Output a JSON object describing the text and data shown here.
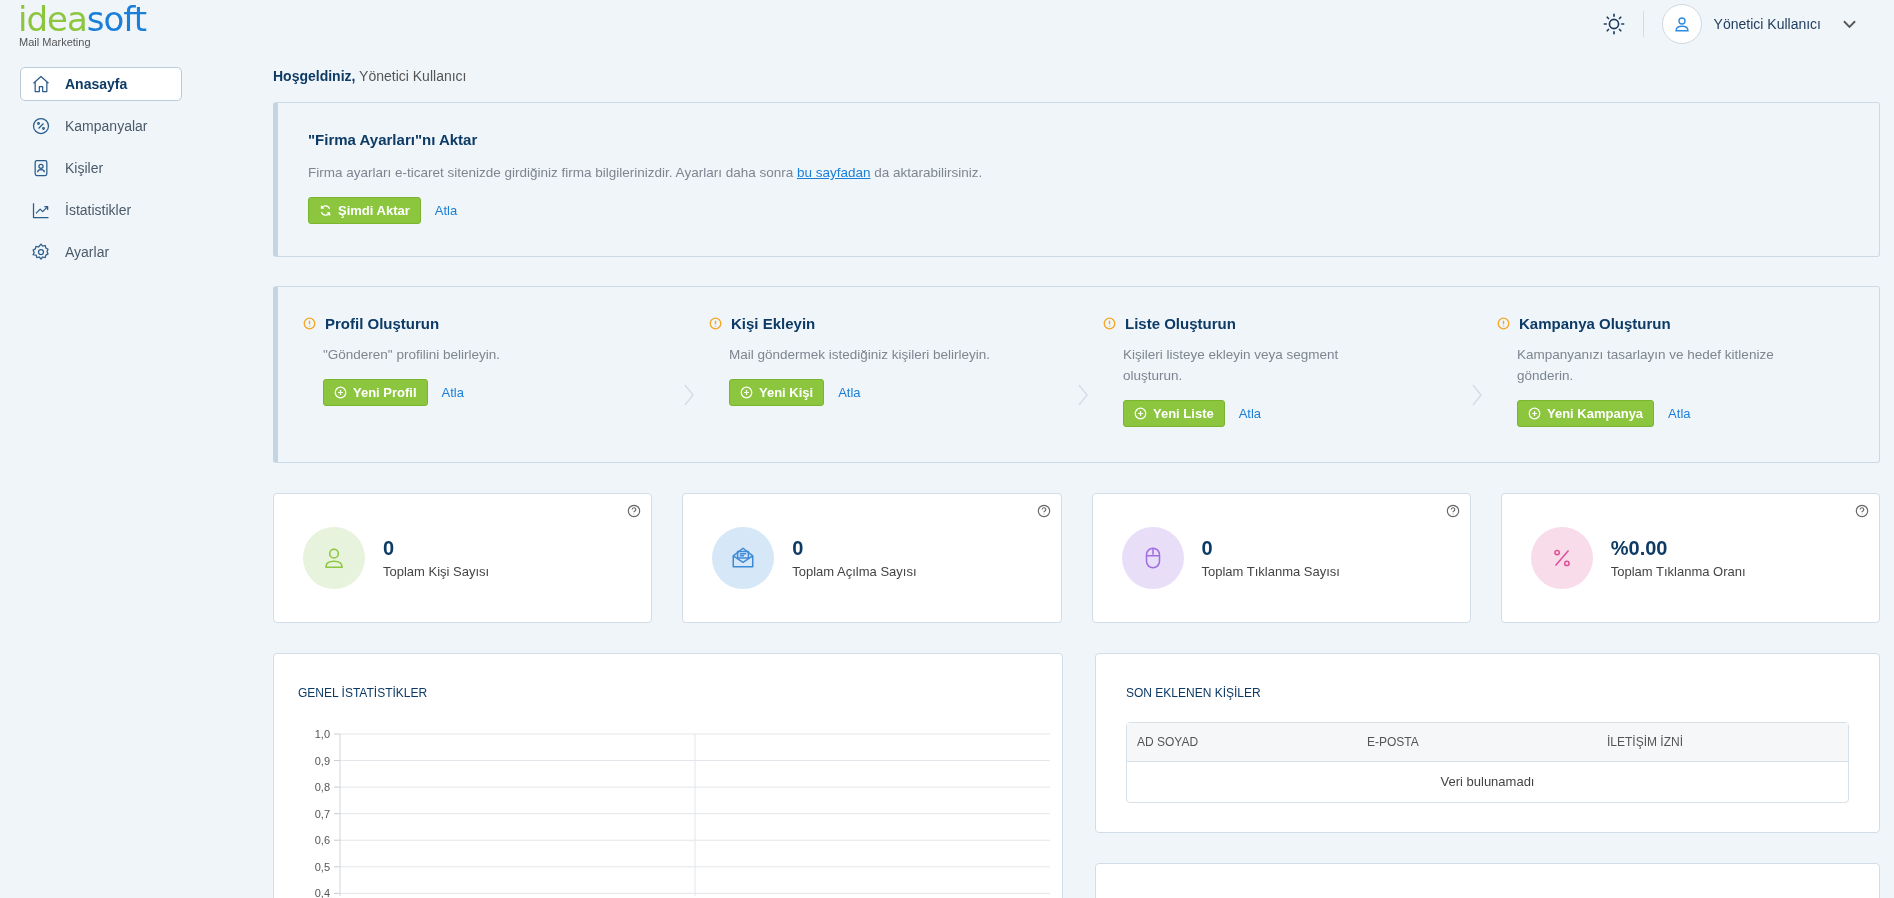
{
  "logo": {
    "part_1": "idea",
    "part_2": "soft",
    "subtitle": "Mail Marketing"
  },
  "header": {
    "user_name": "Yönetici Kullanıcı"
  },
  "sidebar": {
    "items": [
      {
        "label": "Anasayfa",
        "kind": "home",
        "selected": true
      },
      {
        "label": "Kampanyalar",
        "kind": "percent",
        "selected": false
      },
      {
        "label": "Kişiler",
        "kind": "contact",
        "selected": false
      },
      {
        "label": "İstatistikler",
        "kind": "chart",
        "selected": false
      },
      {
        "label": "Ayarlar",
        "kind": "gear",
        "selected": false
      }
    ]
  },
  "welcome": {
    "greeting": "Hoşgeldiniz,",
    "name": "Yönetici Kullanıcı"
  },
  "import_card": {
    "title": "\"Firma Ayarları\"nı Aktar",
    "text_before": "Firma ayarları e-ticaret sitenizde girdiğiniz firma bilgilerinizdir. Ayarları daha sonra",
    "link": "bu sayfadan",
    "text_after": "da aktarabilirsiniz.",
    "button": "Şimdi Aktar",
    "skip": "Atla"
  },
  "steps": [
    {
      "title": "Profil Oluşturun",
      "description": "\"Gönderen\" profilini belirleyin.",
      "button": "Yeni Profil",
      "skip": "Atla"
    },
    {
      "title": "Kişi Ekleyin",
      "description": "Mail göndermek istediğiniz kişileri belirleyin.",
      "button": "Yeni Kişi",
      "skip": "Atla"
    },
    {
      "title": "Liste Oluşturun",
      "description": "Kişileri listeye ekleyin veya segment oluşturun.",
      "button": "Yeni Liste",
      "skip": "Atla"
    },
    {
      "title": "Kampanya Oluşturun",
      "description": "Kampanyanızı tasarlayın ve hedef kitlenize gönderin.",
      "button": "Yeni Kampanya",
      "skip": "Atla"
    }
  ],
  "stats": [
    {
      "value": "0",
      "label": "Toplam Kişi Sayısı",
      "kind": "person"
    },
    {
      "value": "0",
      "label": "Toplam Açılma Sayısı",
      "kind": "envelope"
    },
    {
      "value": "0",
      "label": "Toplam Tıklanma Sayısı",
      "kind": "mouse"
    },
    {
      "value": "%0.00",
      "label": "Toplam Tıklanma Oranı",
      "kind": "percent"
    }
  ],
  "general_stats": {
    "title": "GENEL İSTATİSTİKLER",
    "chart_data": {
      "type": "line",
      "categories": [
        null,
        null
      ],
      "ylim": [
        0.39,
        1
      ],
      "grid": true,
      "yticks": [
        {
          "value": 1,
          "label": "1,0"
        },
        {
          "value": 0.9,
          "label": "0,9"
        },
        {
          "value": 0.8,
          "label": "0,8"
        },
        {
          "value": 0.7,
          "label": "0,7"
        },
        {
          "value": 0.6,
          "label": "0,6"
        },
        {
          "value": 0.5,
          "label": "0,5"
        },
        {
          "value": 0.4,
          "label": "0,4"
        }
      ]
    }
  },
  "recent_contacts": {
    "title": "SON EKLENEN KİŞİLER",
    "columns": [
      "AD SOYAD",
      "E-POSTA",
      "İLETİŞİM İZNİ"
    ],
    "empty_message": "Veri bulunamadı"
  }
}
